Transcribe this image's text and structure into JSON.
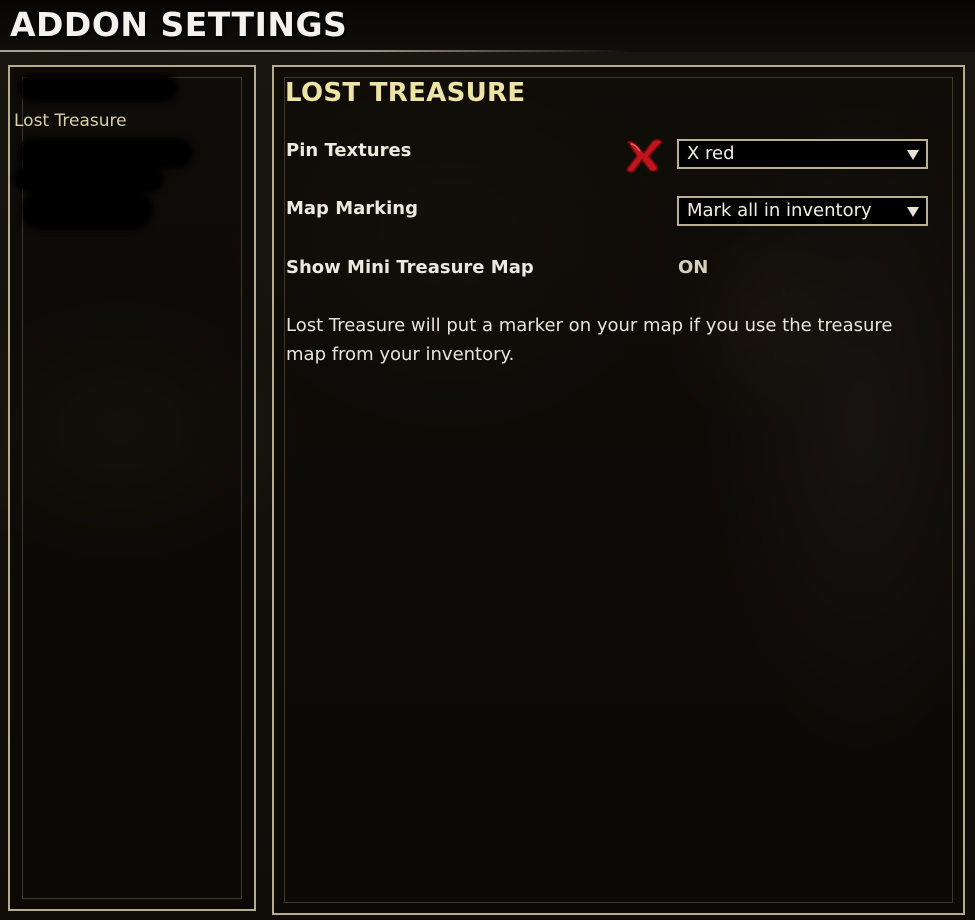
{
  "window": {
    "title": "ADDON SETTINGS"
  },
  "sidebar": {
    "items": [
      {
        "label": "",
        "redacted": true
      },
      {
        "label": "Lost Treasure",
        "selected": true
      },
      {
        "label": "",
        "redacted": true
      },
      {
        "label": "",
        "redacted": true
      },
      {
        "label": "",
        "redacted": true
      }
    ]
  },
  "panel": {
    "title": "LOST TREASURE",
    "settings": {
      "pin_textures": {
        "label": "Pin Textures",
        "value": "X red",
        "icon": "red-x-pin-icon"
      },
      "map_marking": {
        "label": "Map Marking",
        "value": "Mark all in inventory"
      },
      "mini_map": {
        "label": "Show Mini Treasure Map",
        "value": "ON"
      }
    },
    "description": "Lost Treasure will put a marker on your map if you use the treasure map from your inventory."
  },
  "colors": {
    "title_text": "#f4f2ec",
    "section_title": "#ece3a4",
    "border": "#b4ac8e",
    "pin_red": "#c0151b"
  }
}
